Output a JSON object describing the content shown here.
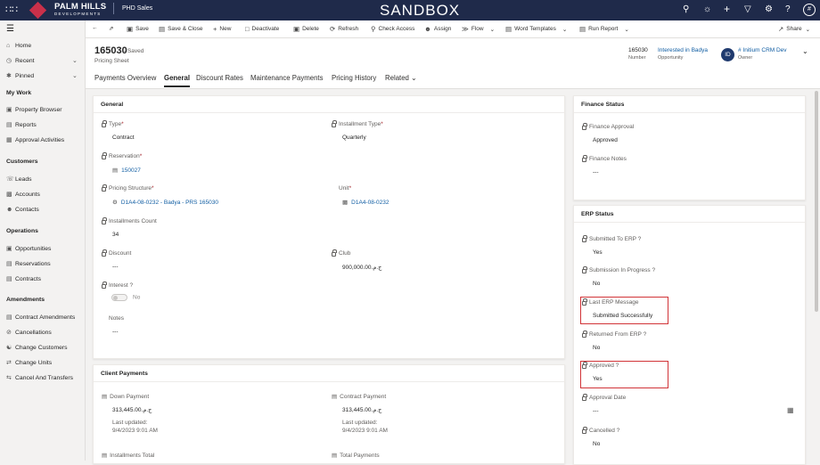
{
  "topbar": {
    "brand": "PALM HILLS",
    "brand_sub": "DEVELOPMENTS",
    "app_name": "PHD Sales",
    "environment": "SANDBOX",
    "user_initial": "#"
  },
  "sidebar": {
    "top_items": [
      {
        "label": "Home",
        "icon": "home-icon"
      },
      {
        "label": "Recent",
        "icon": "clock-icon"
      },
      {
        "label": "Pinned",
        "icon": "pin-icon"
      }
    ],
    "sections": [
      {
        "title": "My Work",
        "items": [
          "Property Browser",
          "Reports",
          "Approval Activities"
        ]
      },
      {
        "title": "Customers",
        "items": [
          "Leads",
          "Accounts",
          "Contacts"
        ]
      },
      {
        "title": "Operations",
        "items": [
          "Opportunities",
          "Reservations",
          "Contracts"
        ]
      },
      {
        "title": "Amendments",
        "items": [
          "Contract Amendments",
          "Cancellations",
          "Change Customers",
          "Change Units",
          "Cancel And Transfers"
        ]
      }
    ]
  },
  "commands": {
    "save": "Save",
    "save_close": "Save & Close",
    "new": "New",
    "deactivate": "Deactivate",
    "delete": "Delete",
    "refresh": "Refresh",
    "check_access": "Check Access",
    "assign": "Assign",
    "flow": "Flow",
    "word_templates": "Word Templates",
    "run_report": "Run Report",
    "share": "Share"
  },
  "record": {
    "title": "165030",
    "saved_status": "- Saved",
    "entity": "Pricing Sheet",
    "number_value": "165030",
    "number_label": "Number",
    "opportunity_value": "Interested in Badya",
    "opportunity_label": "Opportunity",
    "owner_initials": "ID",
    "owner_value": "# Initium CRM Dev",
    "owner_label": "Owner"
  },
  "tabs": [
    "Payments Overview",
    "General",
    "Discount Rates",
    "Maintenance Payments",
    "Pricing History",
    "Related"
  ],
  "general": {
    "title": "General",
    "type_label": "Type",
    "type_value": "Contract",
    "installment_type_label": "Installment Type",
    "installment_type_value": "Quarterly",
    "reservation_label": "Reservation",
    "reservation_value": "150027",
    "pricing_structure_label": "Pricing Structure",
    "pricing_structure_value": "D1A4-08-0232 - Badya - PRS 165030",
    "unit_label": "Unit",
    "unit_value": "D1A4-08-0232",
    "installments_count_label": "Installments Count",
    "installments_count_value": "34",
    "discount_label": "Discount",
    "discount_value": "---",
    "club_label": "Club",
    "club_value": "ج.م.900,000.00",
    "interest_label": "Interest ?",
    "interest_value": "No",
    "notes_label": "Notes",
    "notes_value": "---"
  },
  "client_payments": {
    "title": "Client Payments",
    "down_payment_label": "Down Payment",
    "down_payment_value": "ج.م.313,445.00",
    "down_payment_updated": "Last updated:",
    "down_payment_date": "9/4/2023 9:01 AM",
    "contract_payment_label": "Contract Payment",
    "contract_payment_value": "ج.م.313,445.00",
    "contract_payment_updated": "Last updated:",
    "contract_payment_date": "9/4/2023 9:01 AM",
    "installments_total_label": "Installments Total",
    "total_payments_label": "Total Payments"
  },
  "finance_status": {
    "title": "Finance Status",
    "approval_label": "Finance Approval",
    "approval_value": "Approved",
    "notes_label": "Finance Notes",
    "notes_value": "---"
  },
  "erp_status": {
    "title": "ERP Status",
    "submitted_label": "Submitted To ERP ?",
    "submitted_value": "Yes",
    "in_progress_label": "Submission In Progress ?",
    "in_progress_value": "No",
    "last_msg_label": "Last ERP Message",
    "last_msg_value": "Submitted Successfully",
    "returned_label": "Returned From ERP ?",
    "returned_value": "No",
    "approved_label": "Approved ?",
    "approved_value": "Yes",
    "approval_date_label": "Approval Date",
    "approval_date_value": "---",
    "cancelled_label": "Cancelled ?",
    "cancelled_value": "No"
  },
  "colors": {
    "topbar": "#1f2a4a",
    "brand_red": "#c9304a",
    "link": "#115ea3",
    "highlight": "#d13438"
  }
}
